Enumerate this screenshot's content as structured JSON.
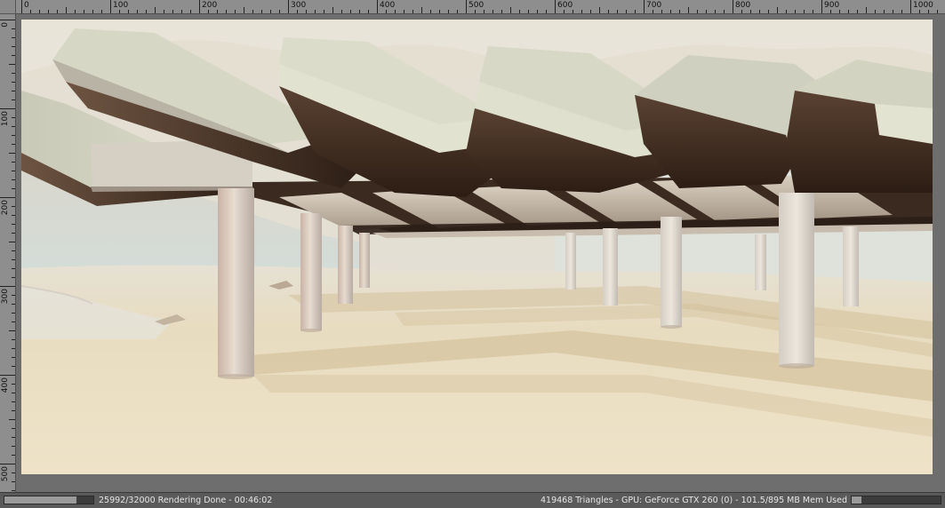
{
  "ruler": {
    "top_labels": [
      "0",
      "100",
      "200",
      "300",
      "400",
      "500",
      "600",
      "700",
      "800",
      "900",
      "1000"
    ],
    "left_labels": [
      "0",
      "100",
      "200",
      "300",
      "400",
      "500"
    ]
  },
  "render": {
    "description_icon": "render-viewport-image"
  },
  "status": {
    "progress_fraction": 0.8122,
    "render_text": "25992/32000 Rendering Done - 00:46:02",
    "scene_text": "419468 Triangles - GPU: GeForce GTX 260 (0) - 101.5/895 MB Mem Used",
    "mem_fraction": 0.113
  }
}
